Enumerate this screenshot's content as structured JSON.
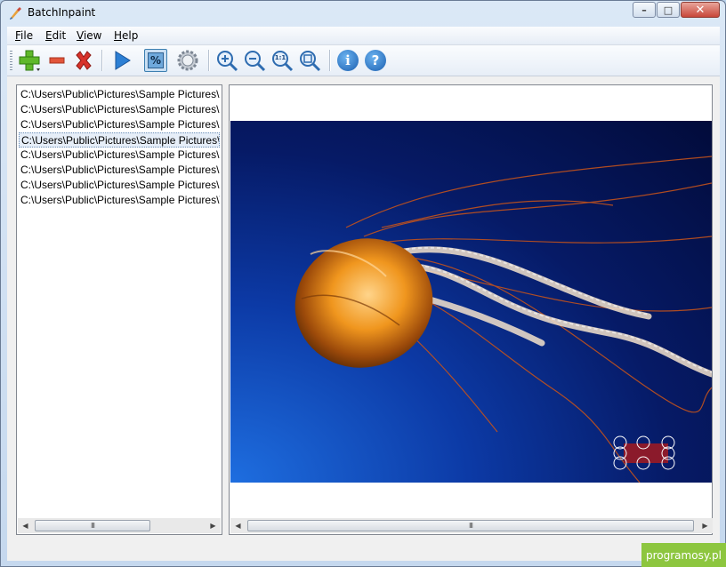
{
  "window": {
    "title": "BatchInpaint"
  },
  "menu": [
    "File",
    "Edit",
    "View",
    "Help"
  ],
  "toolbar": {
    "add": "add-icon",
    "remove": "remove-icon",
    "delete": "delete-icon",
    "run": "play-icon",
    "percent": "%",
    "settings": "settings-icon",
    "zoom_in": "zoom-in-icon",
    "zoom_out": "zoom-out-icon",
    "zoom_actual": "1:1",
    "zoom_fit": "zoom-fit-icon",
    "info": "i",
    "help": "?"
  },
  "files": [
    "C:\\Users\\Public\\Pictures\\Sample Pictures\\C",
    "C:\\Users\\Public\\Pictures\\Sample Pictures\\D",
    "C:\\Users\\Public\\Pictures\\Sample Pictures\\H",
    "C:\\Users\\Public\\Pictures\\Sample Pictures\\J",
    "C:\\Users\\Public\\Pictures\\Sample Pictures\\K",
    "C:\\Users\\Public\\Pictures\\Sample Pictures\\L",
    "C:\\Users\\Public\\Pictures\\Sample Pictures\\P",
    "C:\\Users\\Public\\Pictures\\Sample Pictures\\T"
  ],
  "selected_file_index": 3,
  "scroll_grip": "III",
  "watermark": "programosy.pl",
  "colors": {
    "accent": "#3c7fb1",
    "badge": "#8dc63f",
    "mask": "#8b1a2b"
  }
}
